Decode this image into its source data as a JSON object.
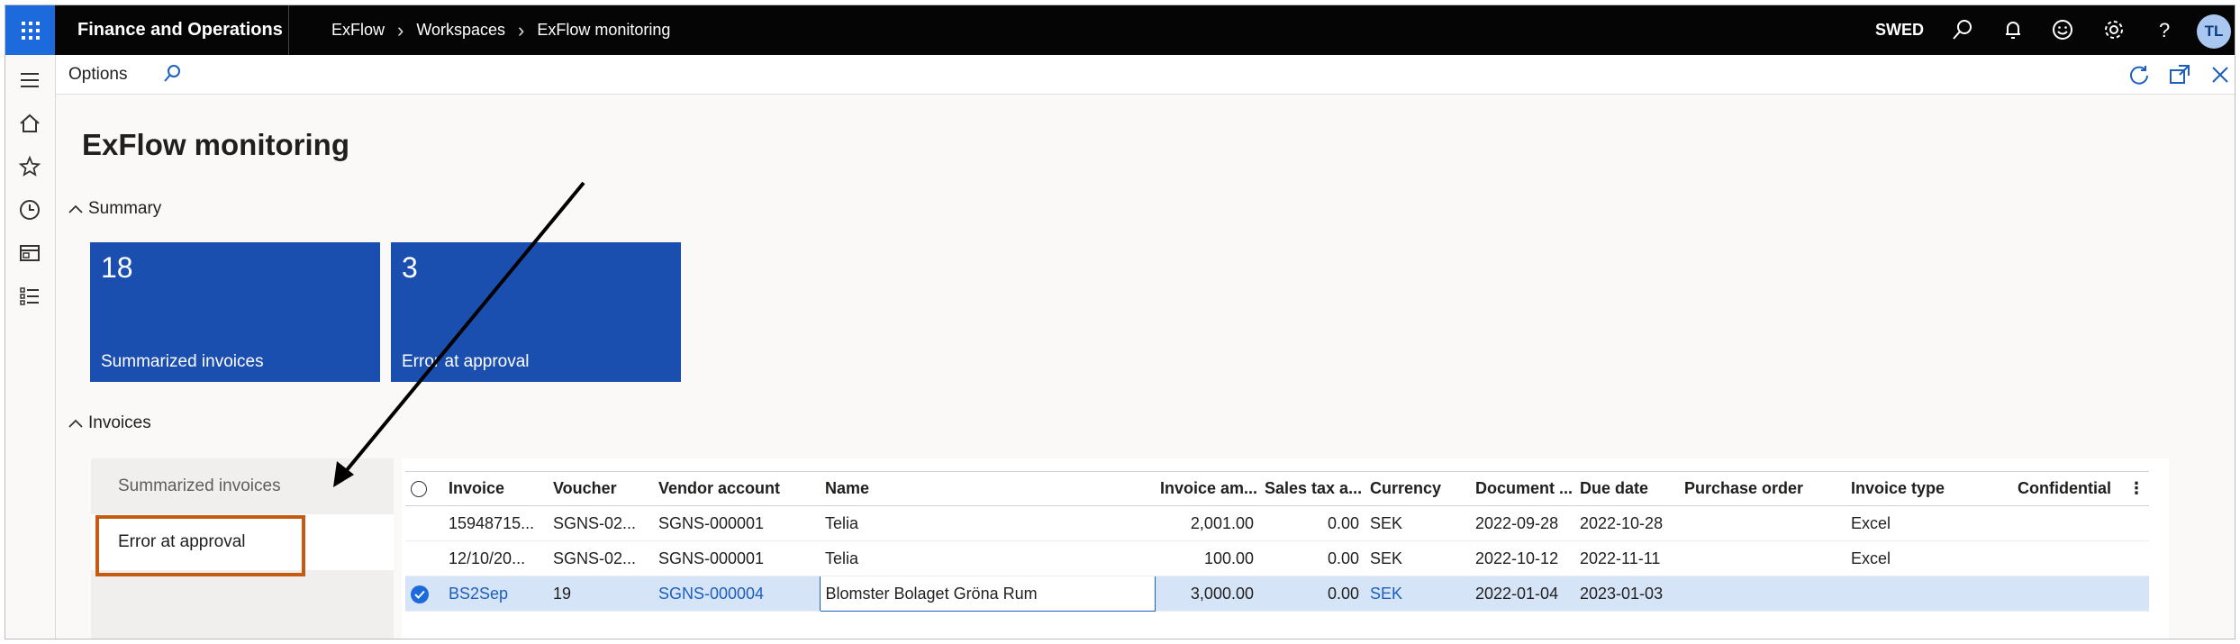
{
  "topbar": {
    "app_name": "Finance and Operations",
    "breadcrumbs": [
      "ExFlow",
      "Workspaces",
      "ExFlow monitoring"
    ],
    "company": "SWED",
    "user_initials": "TL"
  },
  "actionpane": {
    "options_label": "Options"
  },
  "page": {
    "title": "ExFlow monitoring"
  },
  "summary": {
    "label": "Summary",
    "tiles": [
      {
        "count": "18",
        "label": "Summarized invoices"
      },
      {
        "count": "3",
        "label": "Error at approval"
      }
    ]
  },
  "invoices": {
    "label": "Invoices",
    "list": [
      "Summarized invoices",
      "Error at approval"
    ],
    "columns": [
      "Invoice",
      "Voucher",
      "Vendor account",
      "Name",
      "Invoice am...",
      "Sales tax a...",
      "Currency",
      "Document ...",
      "Due date",
      "Purchase order",
      "Invoice type",
      "Confidential"
    ],
    "rows": [
      {
        "invoice": "15948715...",
        "voucher": "SGNS-02...",
        "vendor": "SGNS-000001",
        "name": "Telia",
        "amount": "2,001.00",
        "tax": "0.00",
        "currency": "SEK",
        "document": "2022-09-28",
        "due": "2022-10-28",
        "po": "",
        "type": "Excel",
        "confidential": ""
      },
      {
        "invoice": "12/10/20...",
        "voucher": "SGNS-02...",
        "vendor": "SGNS-000001",
        "name": "Telia",
        "amount": "100.00",
        "tax": "0.00",
        "currency": "SEK",
        "document": "2022-10-12",
        "due": "2022-11-11",
        "po": "",
        "type": "Excel",
        "confidential": ""
      },
      {
        "invoice": "BS2Sep",
        "voucher": "19",
        "vendor": "SGNS-000004",
        "name": "Blomster Bolaget Gröna Rum",
        "amount": "3,000.00",
        "tax": "0.00",
        "currency": "SEK",
        "document": "2022-01-04",
        "due": "2023-01-03",
        "po": "",
        "type": "",
        "confidential": ""
      }
    ]
  },
  "colors": {
    "accent": "#1c6adb",
    "tile": "#1a4fb0",
    "highlight": "#c55a11",
    "topbar": "#050505"
  }
}
